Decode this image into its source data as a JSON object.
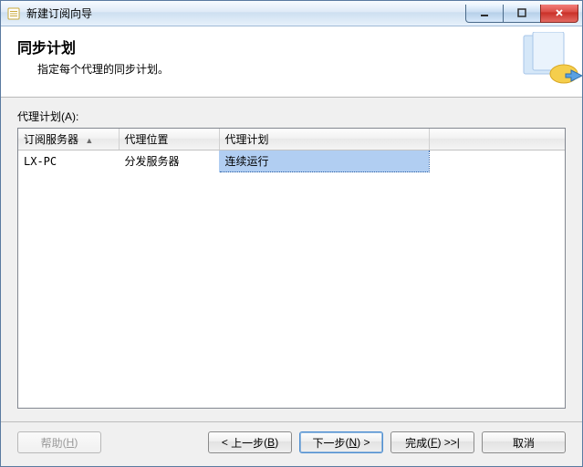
{
  "window": {
    "title": "新建订阅向导"
  },
  "header": {
    "title": "同步计划",
    "subtitle": "指定每个代理的同步计划。"
  },
  "body": {
    "agent_schedule_label": "代理计划(A):"
  },
  "grid": {
    "columns": {
      "subscriber": "订阅服务器",
      "agent_location": "代理位置",
      "agent_schedule": "代理计划"
    },
    "rows": [
      {
        "subscriber": "LX-PC",
        "agent_location": "分发服务器",
        "agent_schedule": "连续运行"
      }
    ]
  },
  "footer": {
    "help": {
      "label": "帮助",
      "mnemonic": "H"
    },
    "back": {
      "label": "上一步",
      "mnemonic": "B"
    },
    "next": {
      "label": "下一步",
      "mnemonic": "N"
    },
    "finish": {
      "label": "完成",
      "mnemonic": "F"
    },
    "cancel": {
      "label": "取消"
    }
  }
}
